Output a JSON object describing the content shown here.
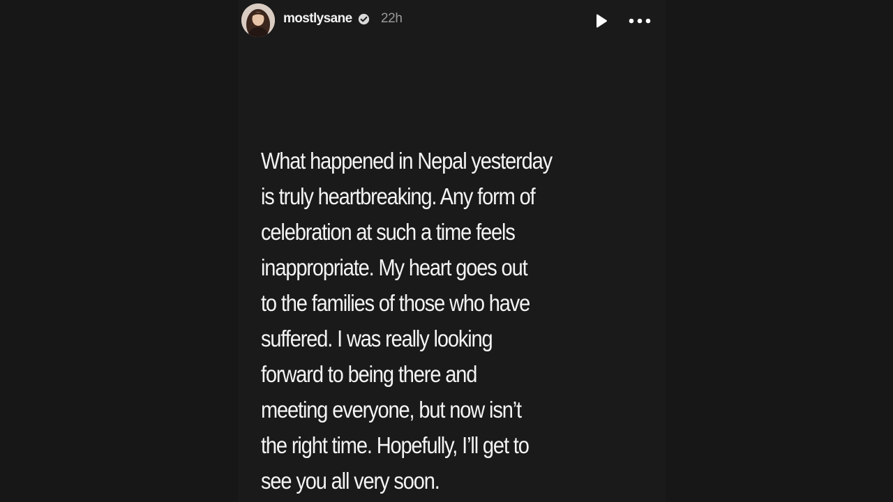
{
  "story": {
    "username": "mostlysane",
    "timestamp": "22h",
    "icons": {
      "avatar": "profile-photo",
      "verified": "verified-badge-icon",
      "play": "play-icon",
      "more": "more-options-icon"
    },
    "text_lines": [
      "What happened in Nepal yesterday",
      "is truly heartbreaking. Any form of",
      "celebration at such a time feels",
      "inappropriate. My heart goes out",
      "to the families of those who have",
      "suffered. I was really looking",
      "forward to being there and",
      "meeting everyone, but now isn’t",
      "the right time. Hopefully, I’ll get to",
      "see you all very soon."
    ]
  },
  "colors": {
    "page_background": "#171717",
    "story_background": "#1a1a1a",
    "text": "#f4f4f4",
    "muted_text": "#9a9a9a"
  }
}
